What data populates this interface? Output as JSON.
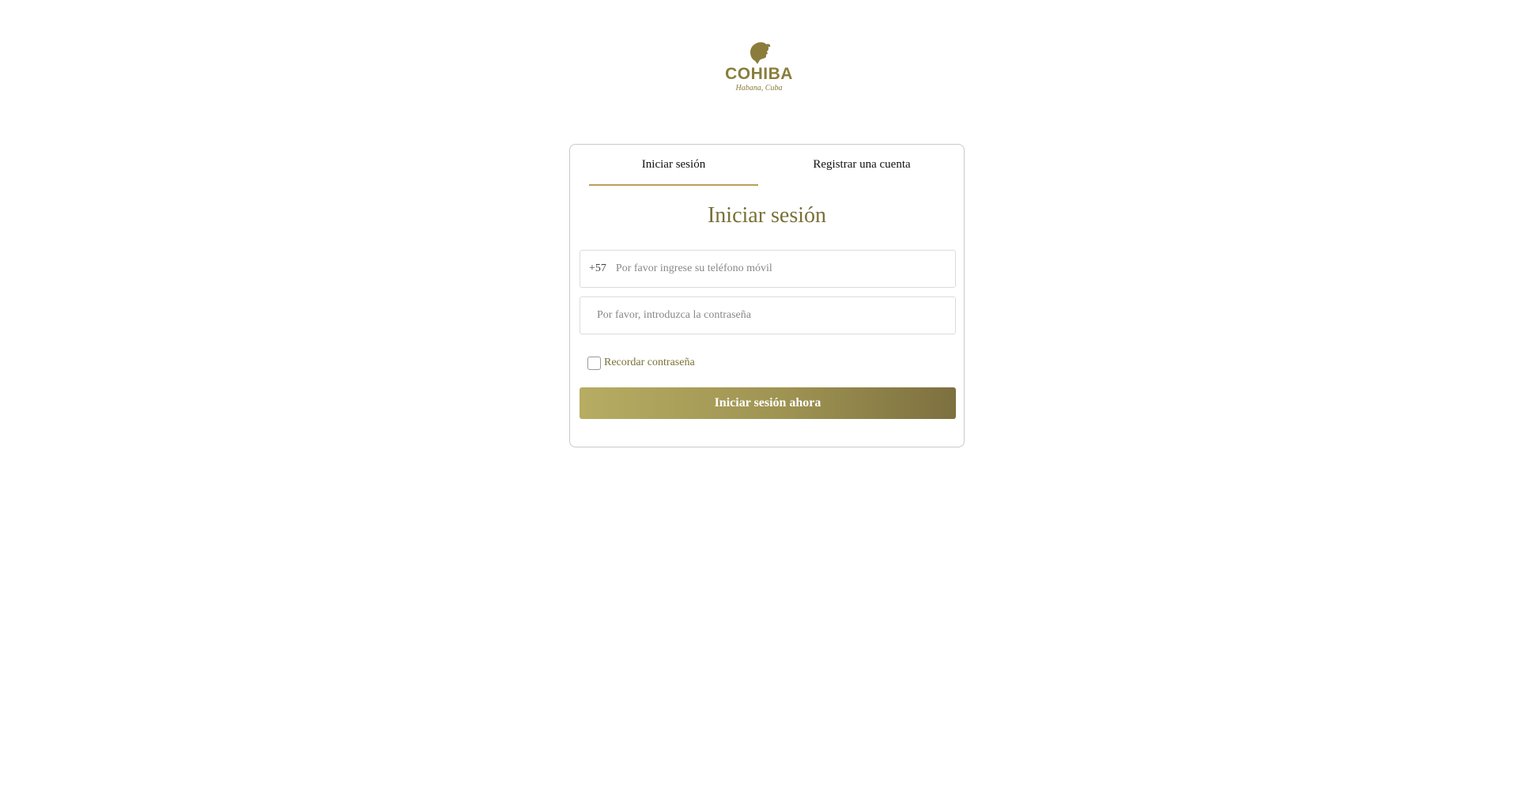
{
  "logo": {
    "brand": "COHIBA",
    "sub": "Habana, Cuba",
    "icon": "woman-head-silhouette-icon"
  },
  "tabs": [
    {
      "label": "Iniciar sesión",
      "active": true
    },
    {
      "label": "Registrar una cuenta",
      "active": false
    }
  ],
  "form": {
    "heading": "Iniciar sesión",
    "phone_prefix": "+57",
    "phone_placeholder": "Por favor ingrese su teléfono móvil",
    "password_placeholder": "Por favor, introduzca la contraseña",
    "remember_label": "Recordar contraseña",
    "remember_checked": false,
    "submit_label": "Iniciar sesión ahora"
  },
  "colors": {
    "accent": "#7a7036",
    "tab_underline": "#b6a25a",
    "button_start": "#b6ac62",
    "button_end": "#7d7040"
  }
}
